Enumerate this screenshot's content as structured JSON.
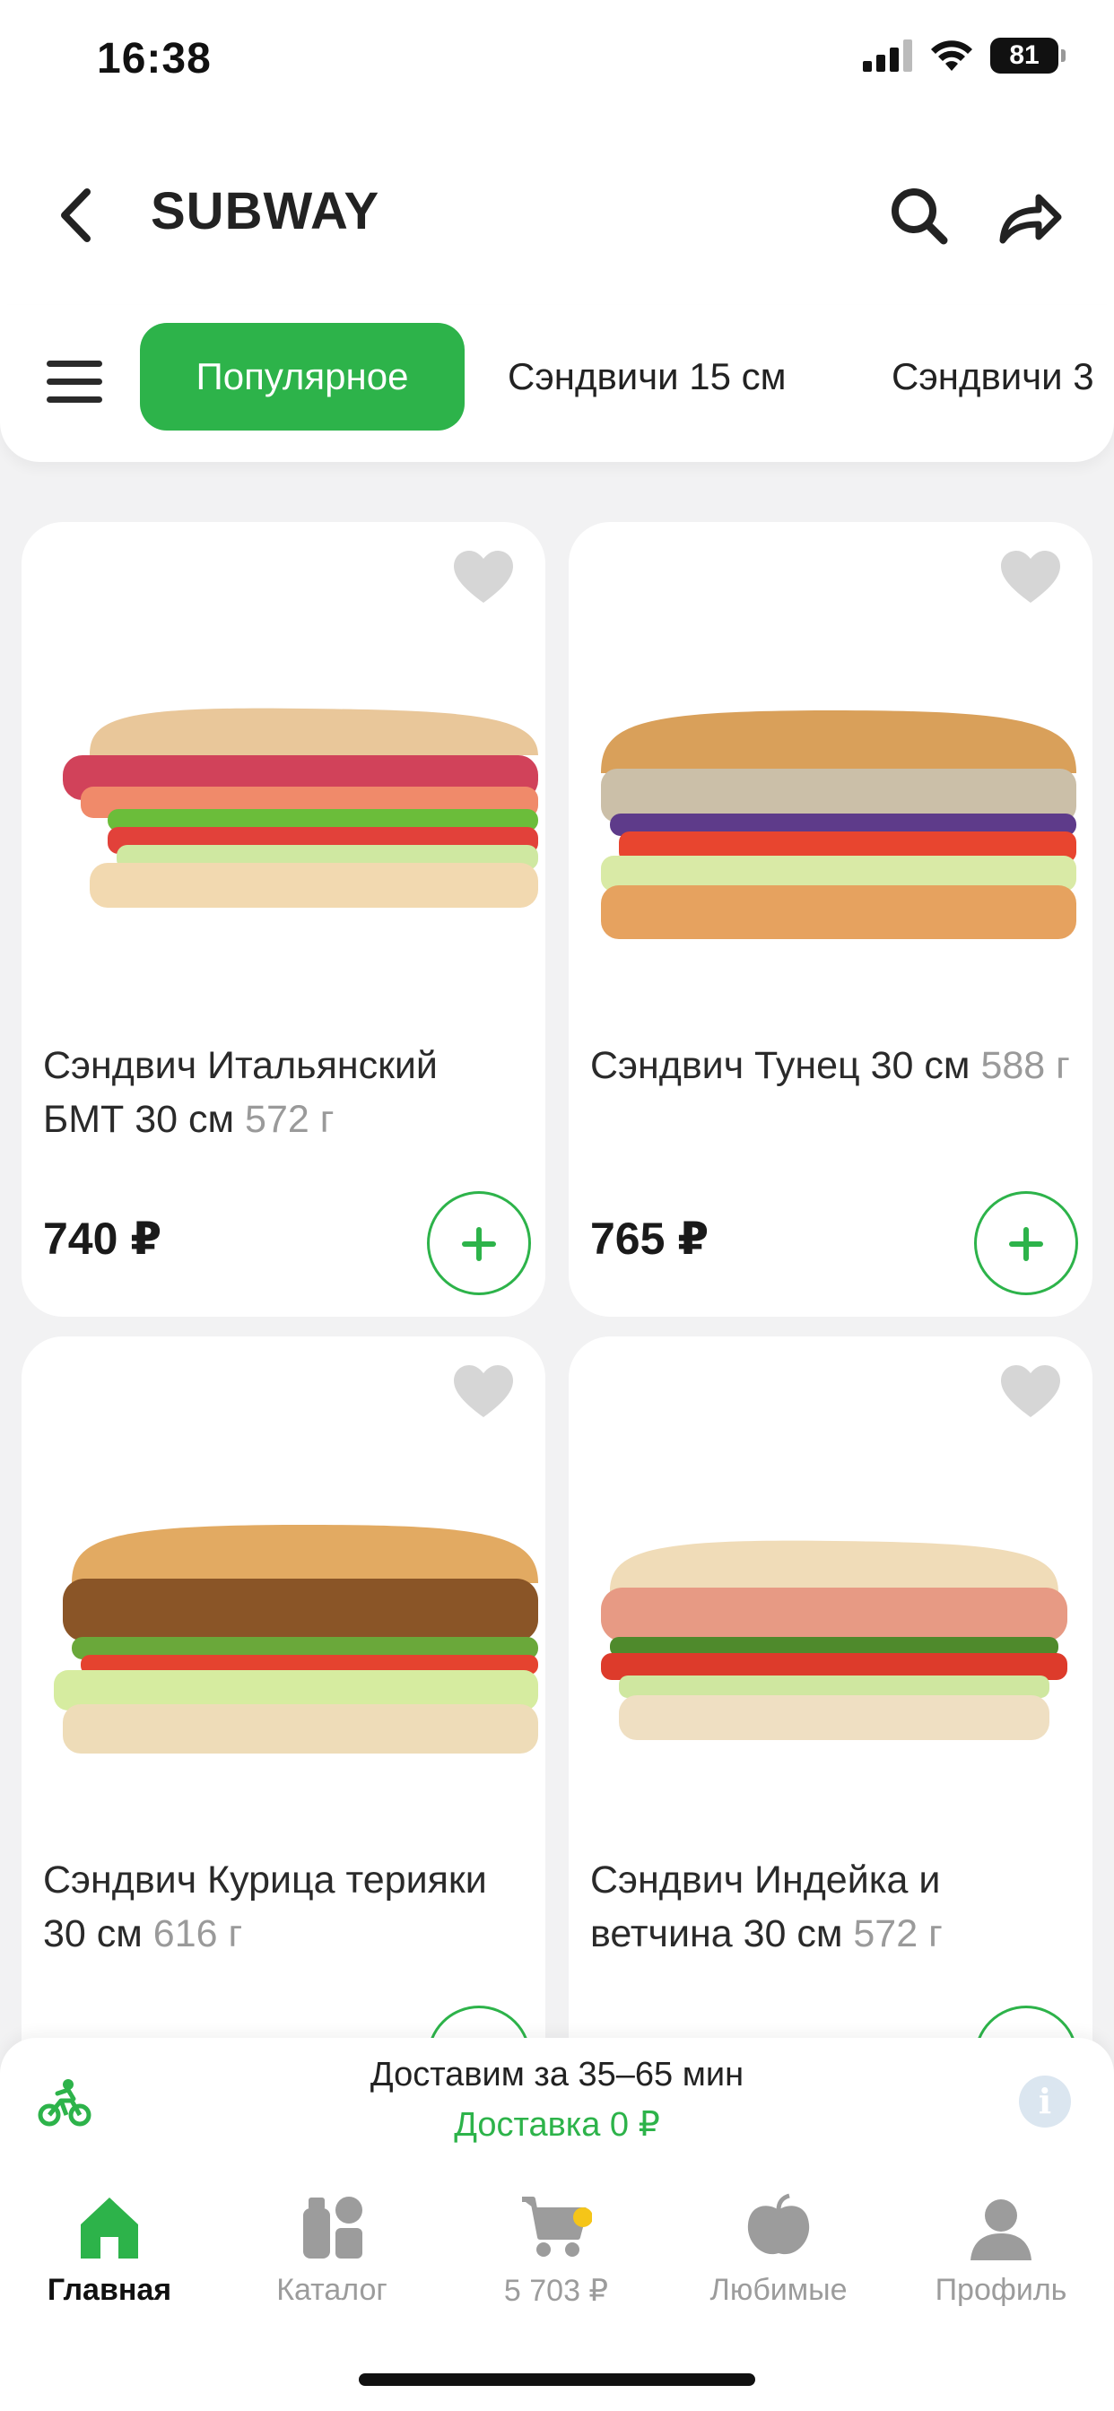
{
  "status_bar": {
    "time": "16:38",
    "battery": "81"
  },
  "header": {
    "title": "SUBWAY"
  },
  "tabs": [
    {
      "label": "Популярное",
      "active": true
    },
    {
      "label": "Сэндвичи 15 см",
      "active": false
    },
    {
      "label": "Сэндвичи 3",
      "active": false
    }
  ],
  "products": [
    {
      "name": "Сэндвич Итальянский БМТ 30 см",
      "weight": "572 г",
      "price": "740 ₽"
    },
    {
      "name": "Сэндвич Тунец 30 см",
      "weight": "588 г",
      "price": "765 ₽"
    },
    {
      "name": "Сэндвич Курица терияки 30 см",
      "weight": "616 г",
      "price": ""
    },
    {
      "name": "Сэндвич Индейка и ветчина 30 см",
      "weight": "572 г",
      "price": ""
    }
  ],
  "delivery": {
    "time_text": "Доставим за 35–65 мин",
    "cost_text": "Доставка 0 ₽"
  },
  "bottom_nav": [
    {
      "label": "Главная",
      "icon": "home-icon",
      "active": true
    },
    {
      "label": "Каталог",
      "icon": "catalog-icon",
      "active": false
    },
    {
      "label": "5 703 ₽",
      "icon": "cart-icon",
      "active": false
    },
    {
      "label": "Любимые",
      "icon": "apple-icon",
      "active": false
    },
    {
      "label": "Профиль",
      "icon": "profile-icon",
      "active": false
    }
  ],
  "colors": {
    "accent": "#2db34a",
    "background": "#f2f2f3",
    "muted": "#9c9c9c"
  }
}
